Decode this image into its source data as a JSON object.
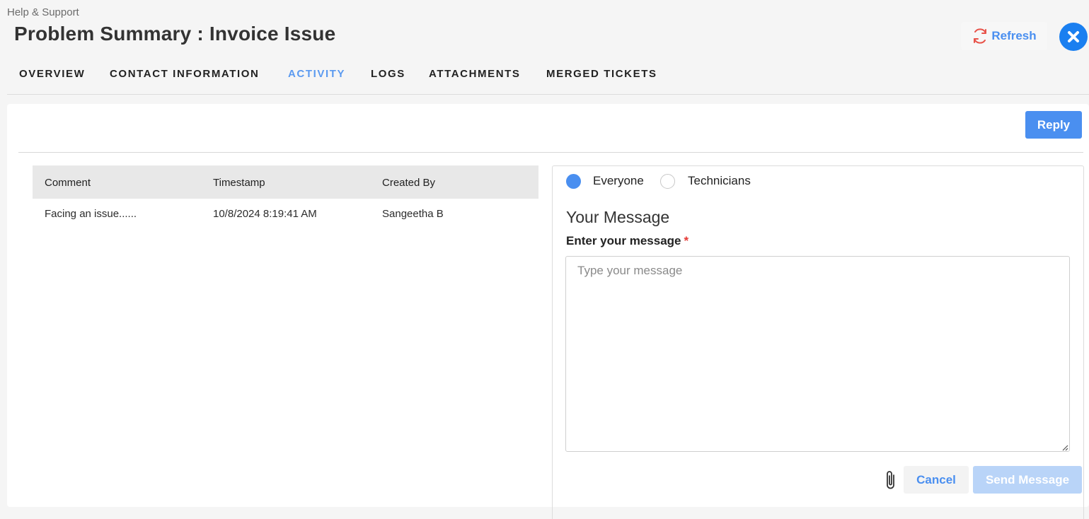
{
  "header": {
    "breadcrumb": "Help & Support",
    "title": "Problem Summary : Invoice Issue",
    "refresh_label": "Refresh",
    "refresh_icon": "refresh-icon",
    "close_icon": "close-icon"
  },
  "tabs": [
    {
      "label": "OVERVIEW",
      "active": false
    },
    {
      "label": "CONTACT INFORMATION",
      "active": false
    },
    {
      "label": "ACTIVITY",
      "active": true
    },
    {
      "label": "LOGS",
      "active": false
    },
    {
      "label": "ATTACHMENTS",
      "active": false
    },
    {
      "label": "MERGED TICKETS",
      "active": false
    }
  ],
  "activity": {
    "reply_label": "Reply",
    "columns": [
      "Comment",
      "Timestamp",
      "Created By"
    ],
    "rows": [
      {
        "comment": "Facing an issue......",
        "timestamp": "10/8/2024 8:19:41 AM",
        "created_by": "Sangeetha B"
      }
    ]
  },
  "compose": {
    "audience_options": [
      {
        "label": "Everyone",
        "selected": true
      },
      {
        "label": "Technicians",
        "selected": false
      }
    ],
    "title": "Your Message",
    "field_label": "Enter your message",
    "required_mark": "*",
    "placeholder": "Type your message",
    "value": "",
    "attach_icon": "paperclip-icon",
    "cancel_label": "Cancel",
    "send_label": "Send Message"
  },
  "colors": {
    "accent": "#4a8ff0",
    "close": "#1a7ff0",
    "refresh_icon": "#e8534a",
    "required": "#e53935",
    "send_disabled": "#b9d4f8"
  }
}
